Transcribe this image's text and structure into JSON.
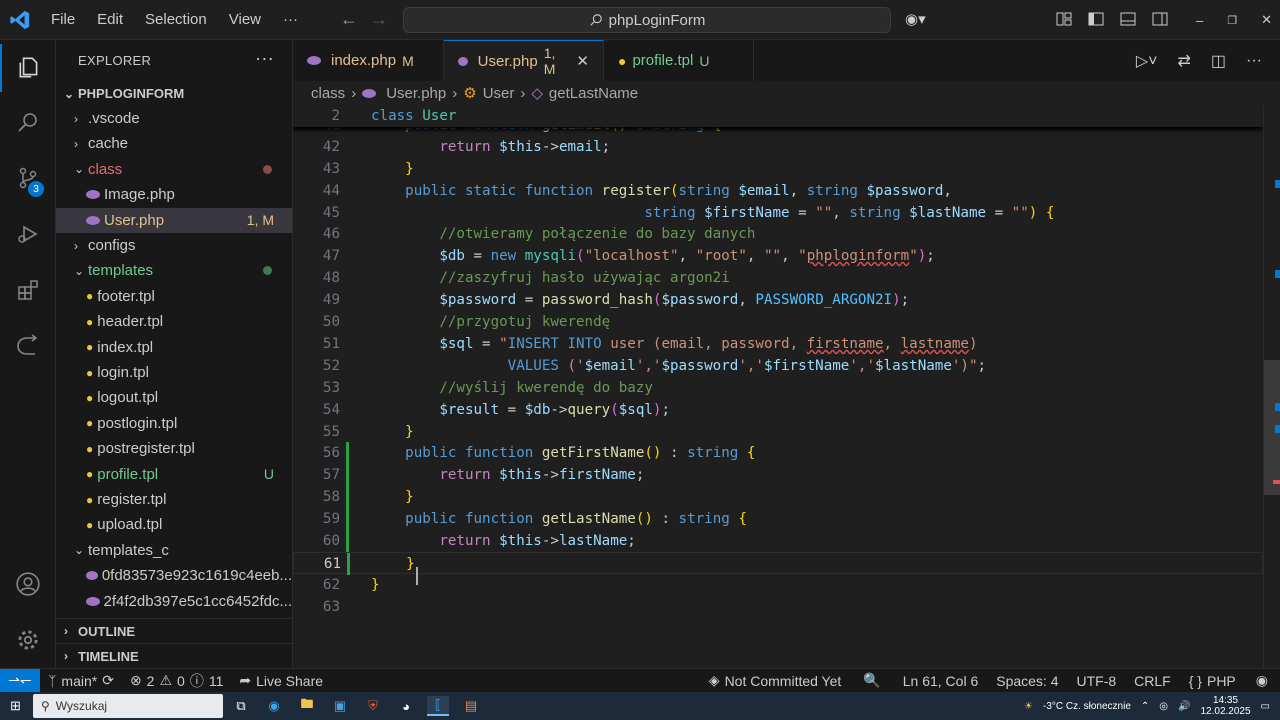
{
  "titlebar": {
    "menus": [
      "File",
      "Edit",
      "Selection",
      "View"
    ],
    "more": "···",
    "search": "phpLoginForm",
    "colors": {
      "accent": "#0078d4",
      "bg": "#1f1f1f"
    }
  },
  "activity": {
    "scm_badge": "3"
  },
  "explorer": {
    "title": "EXPLORER",
    "more": "···",
    "root": "PHPLOGINFORM",
    "items": [
      {
        "label": ".vscode",
        "type": "folder",
        "state": "collapsed"
      },
      {
        "label": "cache",
        "type": "folder",
        "state": "collapsed"
      },
      {
        "label": "class",
        "type": "folder",
        "state": "expanded",
        "status": "dot-modified"
      },
      {
        "label": "Image.php",
        "type": "php"
      },
      {
        "label": "User.php",
        "type": "php",
        "status": "1, M",
        "selected": true
      },
      {
        "label": "configs",
        "type": "folder",
        "state": "collapsed"
      },
      {
        "label": "templates",
        "type": "folder",
        "state": "expanded",
        "status": "dot-untracked"
      },
      {
        "label": "footer.tpl",
        "type": "tpl"
      },
      {
        "label": "header.tpl",
        "type": "tpl"
      },
      {
        "label": "index.tpl",
        "type": "tpl"
      },
      {
        "label": "login.tpl",
        "type": "tpl"
      },
      {
        "label": "logout.tpl",
        "type": "tpl"
      },
      {
        "label": "postlogin.tpl",
        "type": "tpl"
      },
      {
        "label": "postregister.tpl",
        "type": "tpl"
      },
      {
        "label": "profile.tpl",
        "type": "tpl",
        "status": "U"
      },
      {
        "label": "register.tpl",
        "type": "tpl"
      },
      {
        "label": "upload.tpl",
        "type": "tpl"
      },
      {
        "label": "templates_c",
        "type": "folder",
        "state": "expanded"
      },
      {
        "label": "0fd83573e923c1619c4eeb...",
        "type": "php"
      },
      {
        "label": "2f4f2db397e5c1cc6452fdc...",
        "type": "php"
      }
    ],
    "outline": "OUTLINE",
    "timeline": "TIMELINE"
  },
  "tabs": [
    {
      "label": "index.php",
      "status": "M"
    },
    {
      "label": "User.php",
      "status": "1, M",
      "active": true
    },
    {
      "label": "profile.tpl",
      "status": "U"
    }
  ],
  "breadcrumb": [
    "class",
    "User.php",
    "User",
    "getLastName"
  ],
  "code": {
    "sticky": [
      {
        "n": "2",
        "html": "<span class='k'>class</span> <span class='t'>User</span>"
      }
    ],
    "lines": [
      {
        "n": "40",
        "html": "    <span class='b'>}</span>"
      },
      {
        "n": "41",
        "html": "    <span class='k'>public</span> <span class='k'>function</span> <span class='f'>getEmail</span><span class='y'>()</span> : <span class='k'>string</span> <span class='y'>{</span>"
      },
      {
        "n": "42",
        "html": "        <span class='p'>return</span> <span class='v'>$this</span>-><span class='v'>email</span>;"
      },
      {
        "n": "43",
        "html": "    <span class='y'>}</span>"
      },
      {
        "n": "44",
        "html": "    <span class='k'>public</span> <span class='k'>static</span> <span class='k'>function</span> <span class='f'>register</span><span class='y'>(</span><span class='k'>string</span> <span class='v'>$email</span>, <span class='k'>string</span> <span class='v'>$password</span>,"
      },
      {
        "n": "45",
        "html": "                                <span class='k'>string</span> <span class='v'>$firstName</span> = <span class='s'>\"\"</span>, <span class='k'>string</span> <span class='v'>$lastName</span> = <span class='s'>\"\"</span><span class='y'>)</span> <span class='y'>{</span>"
      },
      {
        "n": "46",
        "html": "        <span class='c'>//otwieramy połączenie do bazy danych</span>"
      },
      {
        "n": "47",
        "html": "        <span class='v'>$db</span> = <span class='k'>new</span> <span class='t'>mysqli</span><span class='b'>(</span><span class='s'>\"localhost\"</span>, <span class='s'>\"root\"</span>, <span class='s'>\"\"</span>, <span class='s'>\"<span class='sq'>phploginform</span>\"</span><span class='b'>)</span>;"
      },
      {
        "n": "48",
        "html": "        <span class='c'>//zaszyfruj hasło używając argon2i</span>"
      },
      {
        "n": "49",
        "html": "        <span class='v'>$password</span> = <span class='f'>password_hash</span><span class='b'>(</span><span class='v'>$password</span>, <span class='cst'>PASSWORD_ARGON2I</span><span class='b'>)</span>;"
      },
      {
        "n": "50",
        "html": "        <span class='c'>//przygotuj kwerendę</span>"
      },
      {
        "n": "51",
        "html": "        <span class='v'>$sql</span> = <span class='s'>\"</span><span class='k'>INSERT INTO</span> <span class='s'>user (email, password, <span class='sq'>firstname</span>, <span class='sq'>lastname</span>)</span>"
      },
      {
        "n": "52",
        "html": "                <span class='k'>VALUES</span> <span class='s'>('</span><span class='v'>$email</span><span class='s'>','</span><span class='v'>$password</span><span class='s'>','</span><span class='v'>$firstName</span><span class='s'>','</span><span class='v'>$lastName</span><span class='s'>')\"</span>;"
      },
      {
        "n": "53",
        "html": "        <span class='c'>//wyślij kwerendę do bazy</span>"
      },
      {
        "n": "54",
        "html": "        <span class='v'>$result</span> = <span class='v'>$db</span>-><span class='f'>query</span><span class='b'>(</span><span class='v'>$sql</span><span class='b'>)</span>;"
      },
      {
        "n": "55",
        "html": "    <span class='y'>}</span>"
      },
      {
        "n": "56",
        "html": "    <span class='k'>public</span> <span class='k'>function</span> <span class='f'>getFirstName</span><span class='y'>()</span> : <span class='k'>string</span> <span class='y'>{</span>"
      },
      {
        "n": "57",
        "html": "        <span class='p'>return</span> <span class='v'>$this</span>-><span class='v'>firstName</span>;"
      },
      {
        "n": "58",
        "html": "    <span class='y'>}</span>"
      },
      {
        "n": "59",
        "html": "    <span class='k'>public</span> <span class='k'>function</span> <span class='f'>getLastName</span><span class='y'>()</span> : <span class='k'>string</span> <span class='y'>{</span>"
      },
      {
        "n": "60",
        "html": "        <span class='p'>return</span> <span class='v'>$this</span>-><span class='v'>lastName</span>;"
      },
      {
        "n": "61",
        "html": "    <span class='y'>}</span>"
      },
      {
        "n": "62",
        "html": "<span class='y'>}</span>"
      },
      {
        "n": "63",
        "html": ""
      }
    ],
    "modified_lines": [
      "56",
      "57",
      "58",
      "59",
      "60",
      "61"
    ],
    "current_line": "61"
  },
  "status": {
    "branch": "main*",
    "errors": "2",
    "warnings": "0",
    "infos": "11",
    "liveshare": "Live Share",
    "blame": "Not Committed Yet",
    "position": "Ln 61, Col 6",
    "spaces": "Spaces: 4",
    "encoding": "UTF-8",
    "eol": "CRLF",
    "language": "PHP"
  },
  "taskbar": {
    "search": "Wyszukaj",
    "weather": "-3°C  Cz. słonecznie",
    "time": "14:35",
    "date": "12.02.2025"
  }
}
